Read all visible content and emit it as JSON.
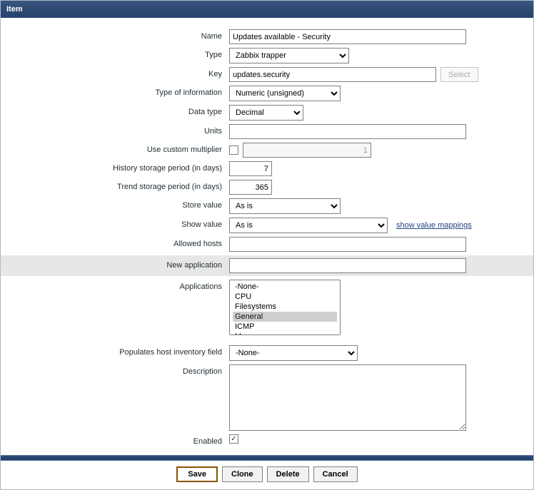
{
  "window": {
    "title": "Item"
  },
  "labels": {
    "name": "Name",
    "type": "Type",
    "key": "Key",
    "type_of_information": "Type of information",
    "data_type": "Data type",
    "units": "Units",
    "use_custom_multiplier": "Use custom multiplier",
    "history_storage": "History storage period (in days)",
    "trend_storage": "Trend storage period (in days)",
    "store_value": "Store value",
    "show_value": "Show value",
    "allowed_hosts": "Allowed hosts",
    "new_application": "New application",
    "applications": "Applications",
    "populates_inventory": "Populates host inventory field",
    "description": "Description",
    "enabled": "Enabled"
  },
  "values": {
    "name": "Updates available - Security",
    "type": "Zabbix trapper",
    "key": "updates.security",
    "type_of_information": "Numeric (unsigned)",
    "data_type": "Decimal",
    "units": "",
    "use_custom_multiplier_checked": false,
    "custom_multiplier": "1",
    "history_storage": "7",
    "trend_storage": "365",
    "store_value": "As is",
    "show_value": "As is",
    "allowed_hosts": "",
    "new_application": "",
    "applications_options": [
      "-None-",
      "CPU",
      "Filesystems",
      "General",
      "ICMP",
      "Memory"
    ],
    "applications_selected": "General",
    "populates_inventory": "-None-",
    "description": "",
    "enabled_checked": true
  },
  "buttons": {
    "select": "Select",
    "save": "Save",
    "clone": "Clone",
    "delete": "Delete",
    "cancel": "Cancel"
  },
  "links": {
    "show_value_mappings": "show value mappings"
  }
}
